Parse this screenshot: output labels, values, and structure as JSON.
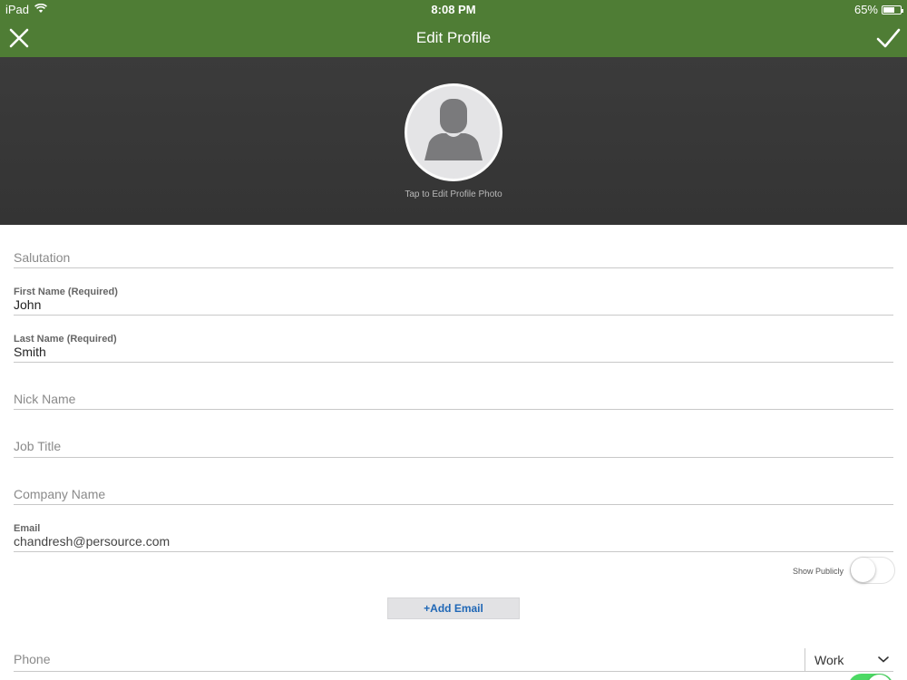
{
  "status_bar": {
    "device": "iPad",
    "time": "8:08 PM",
    "battery": "65%",
    "battery_level": 0.65,
    "wifi_icon": "wifi-icon",
    "battery_icon": "battery-icon"
  },
  "nav": {
    "title": "Edit Profile",
    "close_icon": "close-icon",
    "done_icon": "checkmark-icon"
  },
  "header": {
    "avatar_icon": "person-placeholder-icon",
    "caption": "Tap to Edit Profile Photo"
  },
  "form": {
    "salutation": {
      "placeholder": "Salutation",
      "value": ""
    },
    "first_name": {
      "label": "First Name (Required)",
      "value": "John"
    },
    "last_name": {
      "label": "Last Name (Required)",
      "value": "Smith"
    },
    "nick_name": {
      "placeholder": "Nick Name",
      "value": ""
    },
    "job_title": {
      "placeholder": "Job Title",
      "value": ""
    },
    "company_name": {
      "placeholder": "Company Name",
      "value": ""
    },
    "email": {
      "label": "Email",
      "value": "chandresh@persource.com"
    },
    "email_show_publicly": {
      "label": "Show Publicly",
      "on": false
    },
    "add_email_label": "+Add Email",
    "phone": {
      "placeholder": "Phone",
      "value": "",
      "type": "Work"
    },
    "phone_show_publicly": {
      "on": true
    }
  },
  "colors": {
    "bar": "#4f7d35",
    "header": "#363636",
    "link": "#1f67b6",
    "toggle_on": "#4cd964"
  }
}
